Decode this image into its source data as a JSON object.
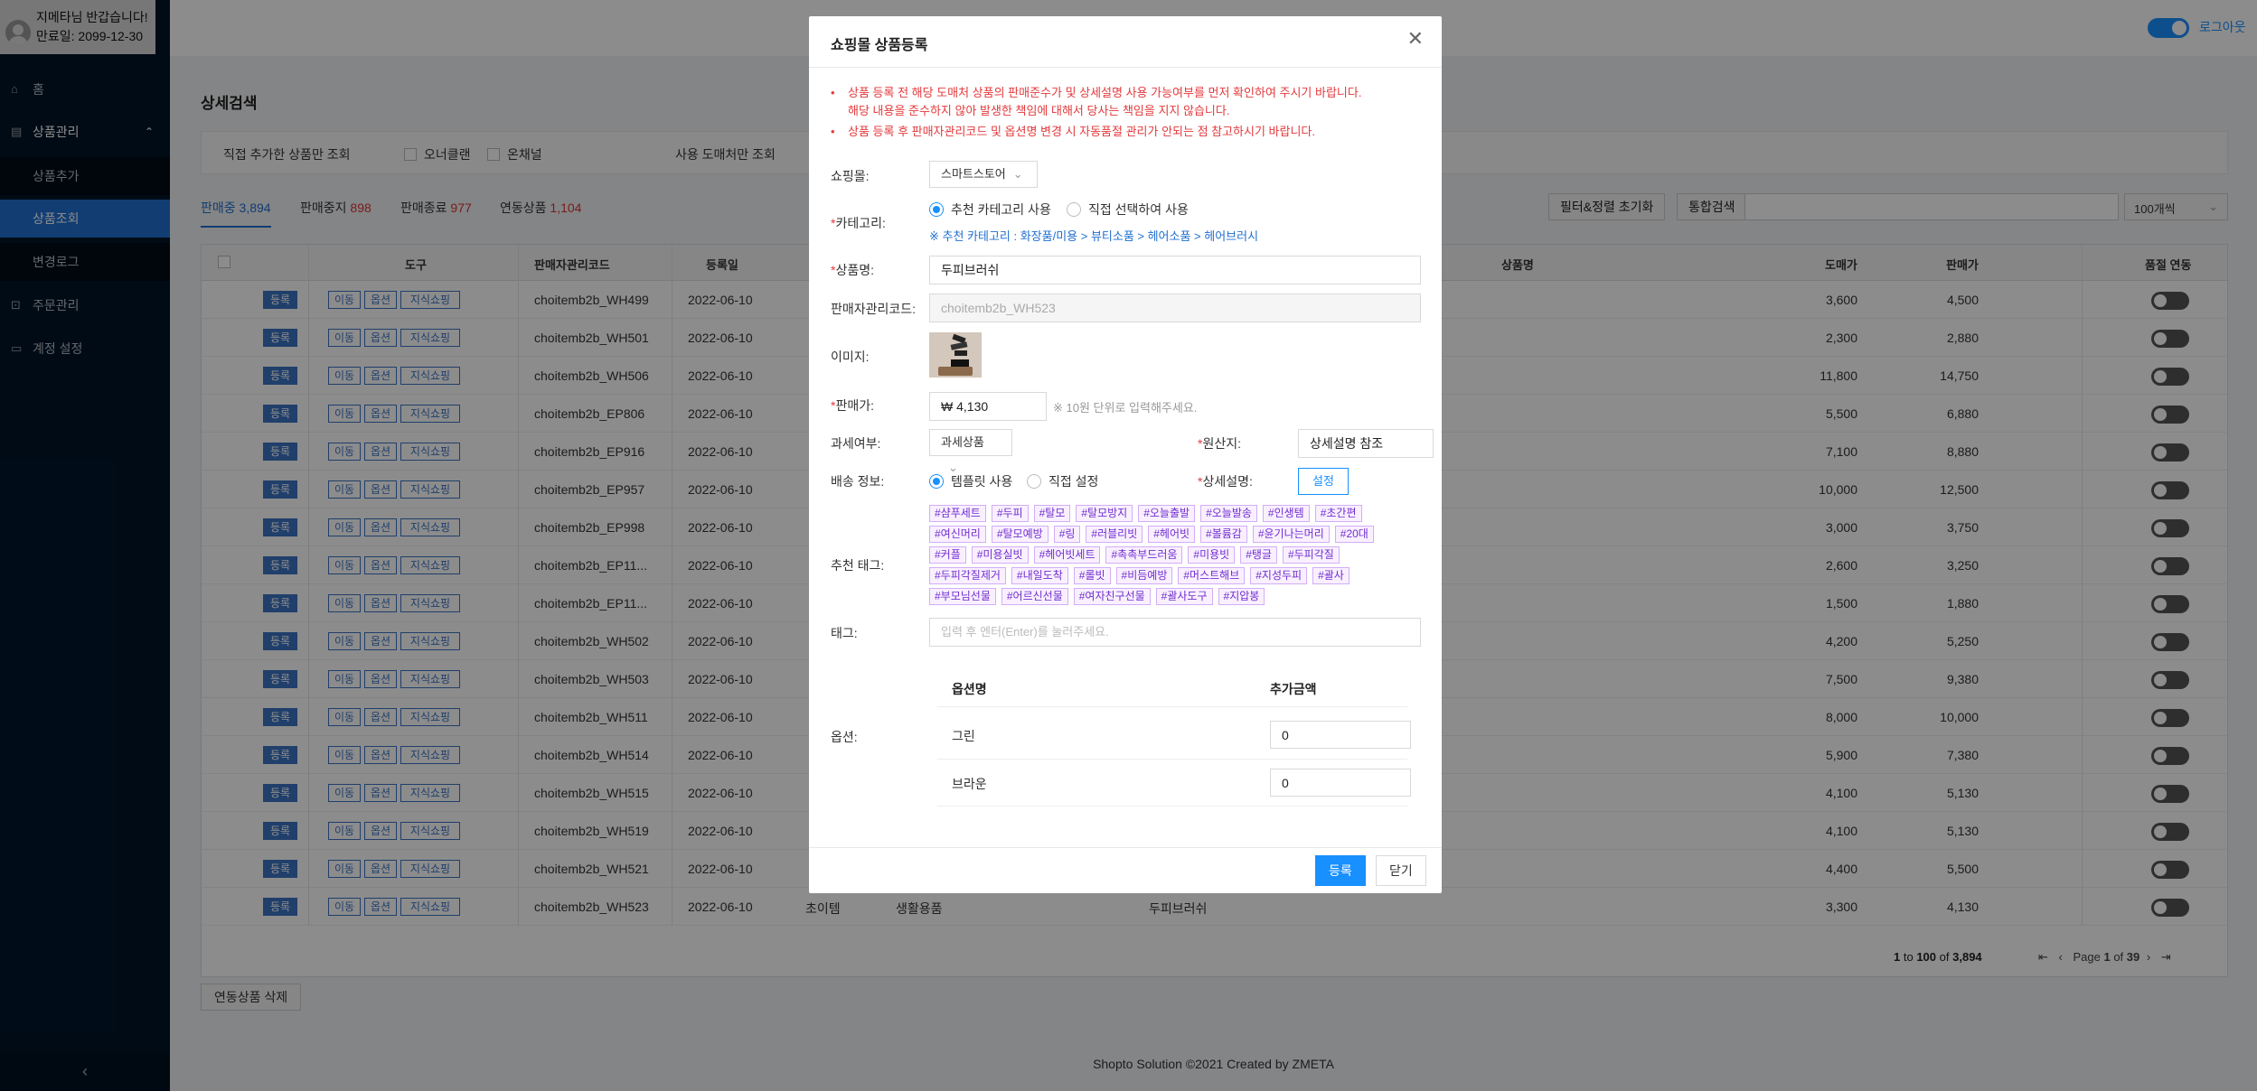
{
  "user": {
    "greeting": "지메타님 반갑습니다!",
    "expiry": "만료일: 2099-12-30"
  },
  "nav": {
    "home": "홈",
    "product_mgmt": "상품관리",
    "add_product": "상품추가",
    "view_product": "상품조회",
    "change_log": "변경로그",
    "order_mgmt": "주문관리",
    "account": "계정 설정",
    "collapse": "‹"
  },
  "header": {
    "logout": "로그아웃"
  },
  "search": {
    "title": "상세검색",
    "direct_only": "직접 추가한 상품만 조회",
    "owner_clan": "오너클랜",
    "on_channel": "온채널",
    "used_vendor": "사용 도매처만 조회"
  },
  "status_tabs": [
    {
      "label": "판매중",
      "count": "3,894"
    },
    {
      "label": "판매중지",
      "count": "898"
    },
    {
      "label": "판매종료",
      "count": "977"
    },
    {
      "label": "연동상품",
      "count": "1,104"
    }
  ],
  "toolbar": {
    "reset": "필터&정렬 초기화",
    "search": "통합검색",
    "page_size": "100개씩"
  },
  "grid": {
    "columns": {
      "tool": "도구",
      "code": "판매자관리코드",
      "date": "등록일",
      "name": "상품명",
      "wholesale": "도매가",
      "price": "판매가",
      "sync": "품절 연동"
    },
    "btn_register": "등록",
    "btn_move": "이동",
    "btn_option": "옵션",
    "btn_knowledge": "지식쇼핑",
    "rows": [
      {
        "code": "choitemb2b_WH499",
        "date": "2022-06-10",
        "wholesale": "3,600",
        "price": "4,500"
      },
      {
        "code": "choitemb2b_WH501",
        "date": "2022-06-10",
        "wholesale": "2,300",
        "price": "2,880"
      },
      {
        "code": "choitemb2b_WH506",
        "date": "2022-06-10",
        "wholesale": "11,800",
        "price": "14,750"
      },
      {
        "code": "choitemb2b_EP806",
        "date": "2022-06-10",
        "wholesale": "5,500",
        "price": "6,880"
      },
      {
        "code": "choitemb2b_EP916",
        "date": "2022-06-10",
        "wholesale": "7,100",
        "price": "8,880"
      },
      {
        "code": "choitemb2b_EP957",
        "date": "2022-06-10",
        "wholesale": "10,000",
        "price": "12,500"
      },
      {
        "code": "choitemb2b_EP998",
        "date": "2022-06-10",
        "wholesale": "3,000",
        "price": "3,750"
      },
      {
        "code": "choitemb2b_EP11...",
        "date": "2022-06-10",
        "wholesale": "2,600",
        "price": "3,250"
      },
      {
        "code": "choitemb2b_EP11...",
        "date": "2022-06-10",
        "wholesale": "1,500",
        "price": "1,880"
      },
      {
        "code": "choitemb2b_WH502",
        "date": "2022-06-10",
        "wholesale": "4,200",
        "price": "5,250"
      },
      {
        "code": "choitemb2b_WH503",
        "date": "2022-06-10",
        "wholesale": "7,500",
        "price": "9,380"
      },
      {
        "code": "choitemb2b_WH511",
        "date": "2022-06-10",
        "wholesale": "8,000",
        "price": "10,000"
      },
      {
        "code": "choitemb2b_WH514",
        "date": "2022-06-10",
        "wholesale": "5,900",
        "price": "7,380"
      },
      {
        "code": "choitemb2b_WH515",
        "date": "2022-06-10",
        "wholesale": "4,100",
        "price": "5,130"
      },
      {
        "code": "choitemb2b_WH519",
        "date": "2022-06-10",
        "wholesale": "4,100",
        "price": "5,130"
      },
      {
        "code": "choitemb2b_WH521",
        "date": "2022-06-10",
        "wholesale": "4,400",
        "price": "5,500"
      },
      {
        "code": "choitemb2b_WH523",
        "date": "2022-06-10",
        "vendor": "초이템",
        "category": "생활용품",
        "name": "두피브러쉬",
        "wholesale": "3,300",
        "price": "4,130"
      }
    ]
  },
  "pager": {
    "range_from": "1",
    "range_to": "100",
    "total": "3,894",
    "page": "1",
    "pages": "39",
    "to": "to",
    "of": "of",
    "page_label": "Page",
    "of2": "of",
    "nav": "⇤ ‹ › ⇥"
  },
  "delete_btn": "연동상품 삭제",
  "footer": "Shopto Solution ©2021 Created by ZMETA",
  "modal": {
    "title": "쇼핑몰 상품등록",
    "close": "✕",
    "notice1_l1": "상품 등록 전 해당 도매처 상품의 판매준수가 및 상세설명 사용 가능여부를 먼저 확인하여 주시기 바랍니다.",
    "notice1_l2": "해당 내용을 준수하지 않아 발생한 책임에 대해서 당사는 책임을 지지 않습니다.",
    "notice2": "상품 등록 후 판매자관리코드 및 옵션명 변경 시 자동품절 관리가 안되는 점 참고하시기 바랍니다.",
    "mall_label": "쇼핑몰:",
    "mall_value": "스마트스토어",
    "category_label": "카테고리:",
    "cat_recommend": "추천 카테고리 사용",
    "cat_direct": "직접 선택하여 사용",
    "cat_note": "※ 추천 카테고리 : 화장품/미용 > 뷰티소품 > 헤어소품 > 헤어브러시",
    "name_label": "상품명:",
    "name_value": "두피브러쉬",
    "code_label": "판매자관리코드:",
    "code_value": "choitemb2b_WH523",
    "image_label": "이미지:",
    "price_label": "판매가:",
    "price_value": "₩ 4,130",
    "price_hint": "※ 10원 단위로 입력해주세요.",
    "tax_label": "과세여부:",
    "tax_value": "과세상품",
    "origin_label": "원산지:",
    "origin_value": "상세설명 참조",
    "ship_label": "배송 정보:",
    "ship_template": "템플릿 사용",
    "ship_direct": "직접 설정",
    "detail_label": "상세설명:",
    "detail_btn": "설정",
    "tags_label": "추천 태그:",
    "tags": [
      "#샴푸세트",
      "#두피",
      "#탈모",
      "#탈모방지",
      "#오늘출발",
      "#오늘발송",
      "#인생템",
      "#초간편",
      "#여신머리",
      "#탈모예방",
      "#링",
      "#러블리빗",
      "#헤어빗",
      "#볼륨감",
      "#윤기나는머리",
      "#20대",
      "#커플",
      "#미용실빗",
      "#헤어빗세트",
      "#촉촉부드러움",
      "#미용빗",
      "#탱글",
      "#두피각질",
      "#두피각질제거",
      "#내일도착",
      "#롤빗",
      "#비듬예방",
      "#머스트해브",
      "#지성두피",
      "#괄사",
      "#부모님선물",
      "#어르신선물",
      "#여자친구선물",
      "#괄사도구",
      "#지압봉"
    ],
    "tag_label": "태그:",
    "tag_placeholder": "입력 후 엔터(Enter)를 눌러주세요.",
    "option_label": "옵션:",
    "opt_col_name": "옵션명",
    "opt_col_price": "추가금액",
    "options": [
      {
        "name": "그린",
        "price": "0"
      },
      {
        "name": "브라운",
        "price": "0"
      }
    ],
    "btn_register": "등록",
    "btn_close": "닫기"
  }
}
